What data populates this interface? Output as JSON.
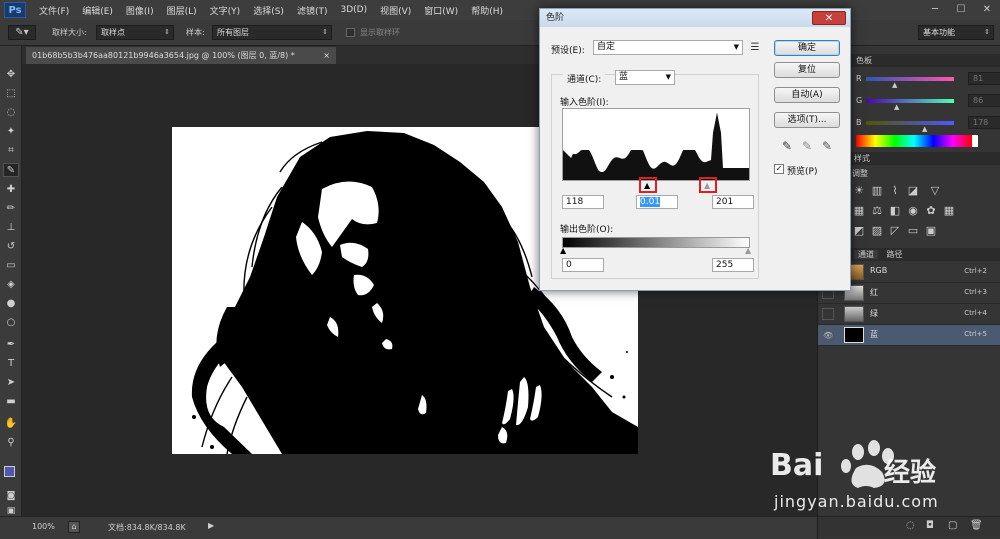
{
  "app": {
    "logo": "Ps",
    "menu": [
      "文件(F)",
      "编辑(E)",
      "图像(I)",
      "图层(L)",
      "文字(Y)",
      "选择(S)",
      "滤镜(T)",
      "3D(D)",
      "视图(V)",
      "窗口(W)",
      "帮助(H)"
    ],
    "window_controls": [
      "─",
      "☐",
      "✕"
    ]
  },
  "options": {
    "sample_size_label": "取样大小:",
    "sample_size_value": "取样点",
    "sample_label": "样本:",
    "sample_value": "所有图层",
    "show_ring_label": "显示取样环",
    "workspace": "基本功能"
  },
  "document": {
    "tab_title": "01b68b5b3b476aa80121b9946a3654.jpg @ 100% (图层 0, 蓝/8) *",
    "zoom": "100%",
    "doc_info": "文档:834.8K/834.8K"
  },
  "levels_dialog": {
    "title": "色阶",
    "close": "✕",
    "preset_label": "预设(E):",
    "preset_value": "自定",
    "channel_label": "通道(C):",
    "channel_value": "蓝",
    "input_levels_label": "输入色阶(I):",
    "input_black": "118",
    "input_gray": "0.01",
    "input_white": "201",
    "output_levels_label": "输出色阶(O):",
    "output_black": "0",
    "output_white": "255",
    "buttons": {
      "ok": "确定",
      "reset": "复位",
      "auto": "自动(A)",
      "options": "选项(T)..."
    },
    "preview_label": "预览(P)",
    "preview_checked": true,
    "histogram_peak_percent": 95
  },
  "color_panel": {
    "tab": "色板",
    "sliders": [
      {
        "label": "R",
        "value": "81"
      },
      {
        "label": "G",
        "value": "86"
      },
      {
        "label": "B",
        "value": "178"
      }
    ]
  },
  "adjustments_panel": {
    "tab": "样式",
    "title": "调整"
  },
  "channels_panel": {
    "tabs": [
      "通道",
      "路径"
    ],
    "channels": [
      {
        "name": "RGB",
        "shortcut": "Ctrl+2",
        "visible": false
      },
      {
        "name": "红",
        "shortcut": "Ctrl+3",
        "visible": false
      },
      {
        "name": "绿",
        "shortcut": "Ctrl+4",
        "visible": false
      },
      {
        "name": "蓝",
        "shortcut": "Ctrl+5",
        "visible": true
      }
    ]
  },
  "watermark": {
    "brand": "Bai",
    "brand2": "经验",
    "url": "jingyan.baidu.com"
  },
  "colors": {
    "accent": "#e02020",
    "fg_swatch": "#5156b2",
    "bg_swatch": "#ffffff"
  }
}
